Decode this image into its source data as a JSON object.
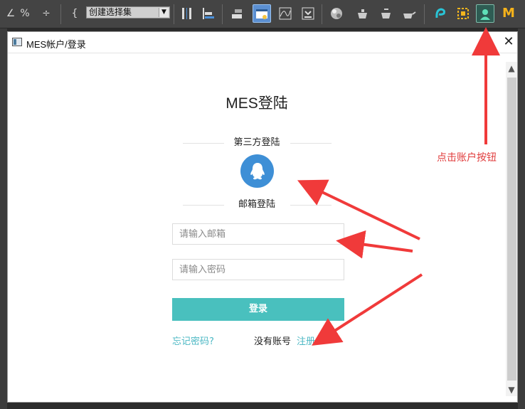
{
  "toolbar": {
    "tools": [
      {
        "name": "snap-icon",
        "glyph": "∠"
      },
      {
        "name": "percent-snap-icon",
        "glyph": "%"
      },
      {
        "name": "spinner-snap-icon",
        "glyph": "÷"
      },
      {
        "name": "edit-named-sets-icon",
        "glyph": "{"
      },
      {
        "name": "mirror-icon",
        "glyph": "▌"
      },
      {
        "name": "align-icon",
        "glyph": "▬"
      },
      {
        "name": "layer-explorer-icon",
        "glyph": "▤"
      },
      {
        "name": "scene-explorer-icon",
        "glyph": "▦"
      },
      {
        "name": "curve-editor-icon",
        "glyph": "∿"
      },
      {
        "name": "dope-sheet-icon",
        "glyph": "▣"
      },
      {
        "name": "material-editor-icon",
        "glyph": "◍"
      },
      {
        "name": "render-setup-icon",
        "glyph": "☕"
      },
      {
        "name": "rendered-frame-icon",
        "glyph": "♨"
      },
      {
        "name": "render-icon",
        "glyph": "☁"
      },
      {
        "name": "plugin-a-icon",
        "glyph": "ʕ"
      },
      {
        "name": "plugin-b-icon",
        "glyph": "▢"
      },
      {
        "name": "account-icon",
        "glyph": "☺"
      },
      {
        "name": "plugin-m-icon",
        "glyph": "M"
      }
    ],
    "selection_set": "创建选择集",
    "selection_set_arrow": "▼"
  },
  "dialog": {
    "title": "MES帐户/登录",
    "close_glyph": "✕",
    "heading": "MES登陆",
    "third_party_title": "第三方登陆",
    "email_title": "邮箱登陆",
    "email_placeholder": "请输入邮箱",
    "password_placeholder": "请输入密码",
    "login_label": "登录",
    "forgot_label": "忘记密码?",
    "no_account_label": "没有账号",
    "register_label": "注册",
    "scroll_up": "▲",
    "scroll_down": "▼"
  },
  "annotation": {
    "text": "点击账户按钮",
    "color": "#e03b3b"
  },
  "colors": {
    "accent": "#49c0be",
    "link": "#4cb8c4",
    "qq": "#3e8fd6",
    "toolbar_active": "#5b8fd1"
  }
}
